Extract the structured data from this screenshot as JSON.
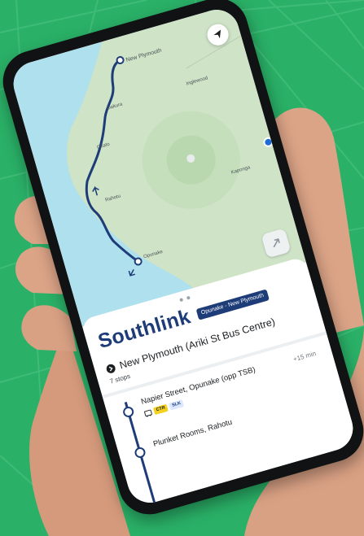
{
  "map": {
    "towns": [
      {
        "name": "New Plymouth"
      },
      {
        "name": "Inglewood"
      },
      {
        "name": "Oakura"
      },
      {
        "name": "Okato"
      },
      {
        "name": "Rahotu"
      },
      {
        "name": "Kaponga"
      },
      {
        "name": "Opunake"
      }
    ],
    "route_color": "#1d3c78",
    "land_color": "#cfe3c7",
    "sea_color": "#aee0ee"
  },
  "route": {
    "name": "Southlink",
    "badge": "Opunake - New Plymouth",
    "destination": "New Plymouth (Ariki St Bus Centre)",
    "stops_count": "7 stops"
  },
  "stops": [
    {
      "name": "Napier Street, Opunake (opp TSB)",
      "offset": "+15 min",
      "tags": [
        "CTR",
        "SLK"
      ]
    },
    {
      "name": "Plunket Rooms, Rahotu"
    }
  ],
  "colors": {
    "background": "#2ab067",
    "accent": "#1d3c78",
    "ctr_tag": "#f2d21e"
  },
  "icons": {
    "locate": "navigation-arrow-icon",
    "share": "share-arrow-icon",
    "bus": "bus-icon",
    "destination": "chevron-circle-icon"
  }
}
